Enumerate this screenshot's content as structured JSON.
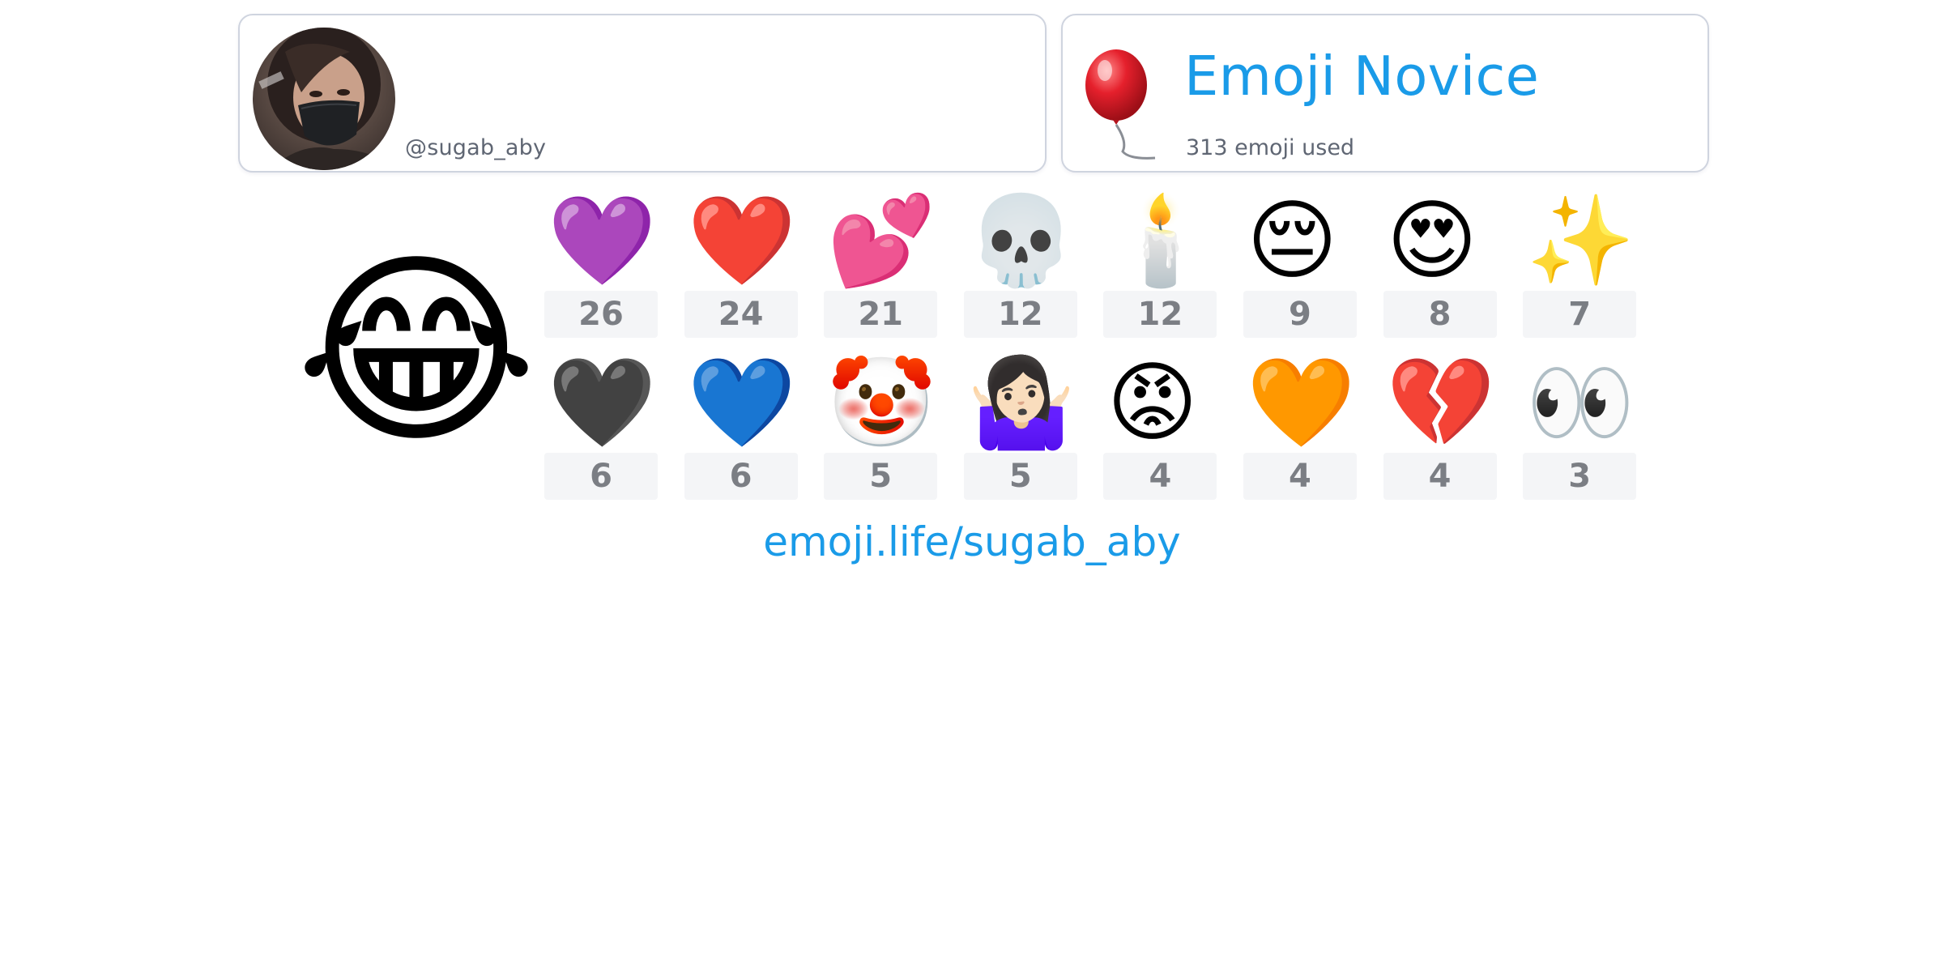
{
  "profile": {
    "username": "@sugab_aby"
  },
  "rank": {
    "title": "Emoji Novice",
    "subtitle": "313 emoji used",
    "icon": "balloon-icon"
  },
  "featured": {
    "emoji": "😂",
    "icon": "face-with-tears-of-joy-icon"
  },
  "emoji_counts": [
    {
      "emoji": "💜",
      "count": "26"
    },
    {
      "emoji": "❤️",
      "count": "24"
    },
    {
      "emoji": "💕",
      "count": "21"
    },
    {
      "emoji": "💀",
      "count": "12"
    },
    {
      "emoji": "🕯️",
      "count": "12"
    },
    {
      "emoji": "😔",
      "count": "9"
    },
    {
      "emoji": "😍",
      "count": "8"
    },
    {
      "emoji": "✨",
      "count": "7"
    },
    {
      "emoji": "🖤",
      "count": "6"
    },
    {
      "emoji": "💙",
      "count": "6"
    },
    {
      "emoji": "🤡",
      "count": "5"
    },
    {
      "emoji": "🤷🏻‍♀️",
      "count": "5"
    },
    {
      "emoji": "😡",
      "count": "4"
    },
    {
      "emoji": "🧡",
      "count": "4"
    },
    {
      "emoji": "💔",
      "count": "4"
    },
    {
      "emoji": "👀",
      "count": "3"
    }
  ],
  "footer": {
    "link_text": "emoji.life/sugab_aby"
  },
  "colors": {
    "accent": "#1a9be8",
    "muted_text": "#5f6673",
    "count_text": "#7b7e84",
    "count_bg": "#f4f5f7",
    "card_border": "#cfd4df"
  }
}
